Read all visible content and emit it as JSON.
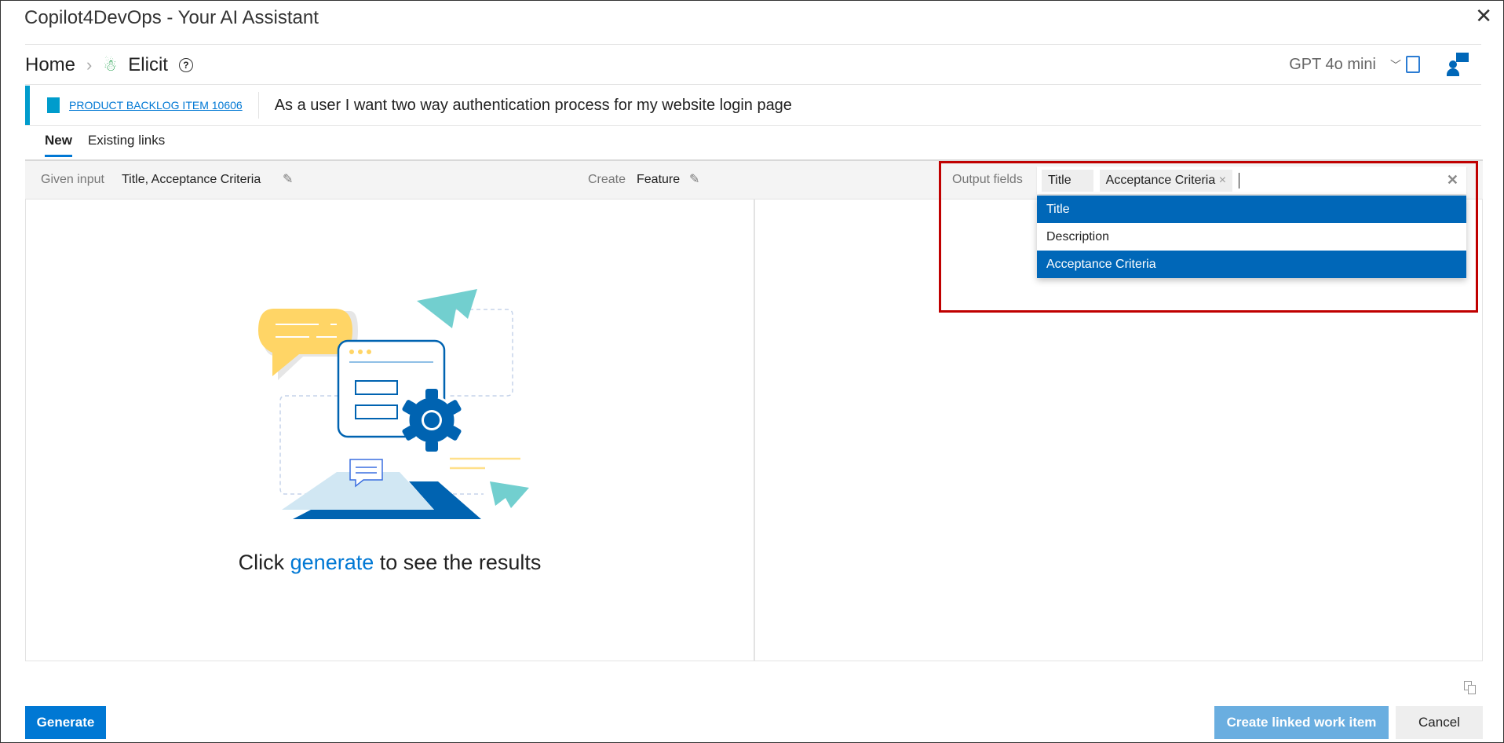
{
  "window": {
    "title": "Copilot4DevOps - Your AI Assistant",
    "close_icon": "close-icon"
  },
  "breadcrumb": {
    "home": "Home",
    "current": "Elicit"
  },
  "header": {
    "model": "GPT 4o mini"
  },
  "work_item": {
    "type_id": "PRODUCT BACKLOG ITEM 10606",
    "title": "As a user I want two way authentication process for my website login page"
  },
  "tabs": [
    {
      "label": "New",
      "active": true
    },
    {
      "label": "Existing links",
      "active": false
    }
  ],
  "toolbar": {
    "given_input_label": "Given input",
    "given_input_value": "Title,  Acceptance Criteria",
    "create_label": "Create",
    "create_value": "Feature",
    "output_fields_label": "Output fields",
    "selected_tags": [
      "Title",
      "Acceptance Criteria"
    ]
  },
  "dropdown": {
    "options": [
      {
        "label": "Title",
        "selected": true
      },
      {
        "label": "Description",
        "selected": false
      },
      {
        "label": "Acceptance Criteria",
        "selected": true
      }
    ]
  },
  "empty_state": {
    "prefix": "Click ",
    "link": "generate",
    "suffix": " to see the results"
  },
  "footer": {
    "generate": "Generate",
    "create_linked": "Create linked work item",
    "cancel": "Cancel"
  },
  "colors": {
    "accent": "#0078d4",
    "selected": "#0067b8",
    "highlight_border": "#c00000",
    "banner": "#009ccc"
  }
}
